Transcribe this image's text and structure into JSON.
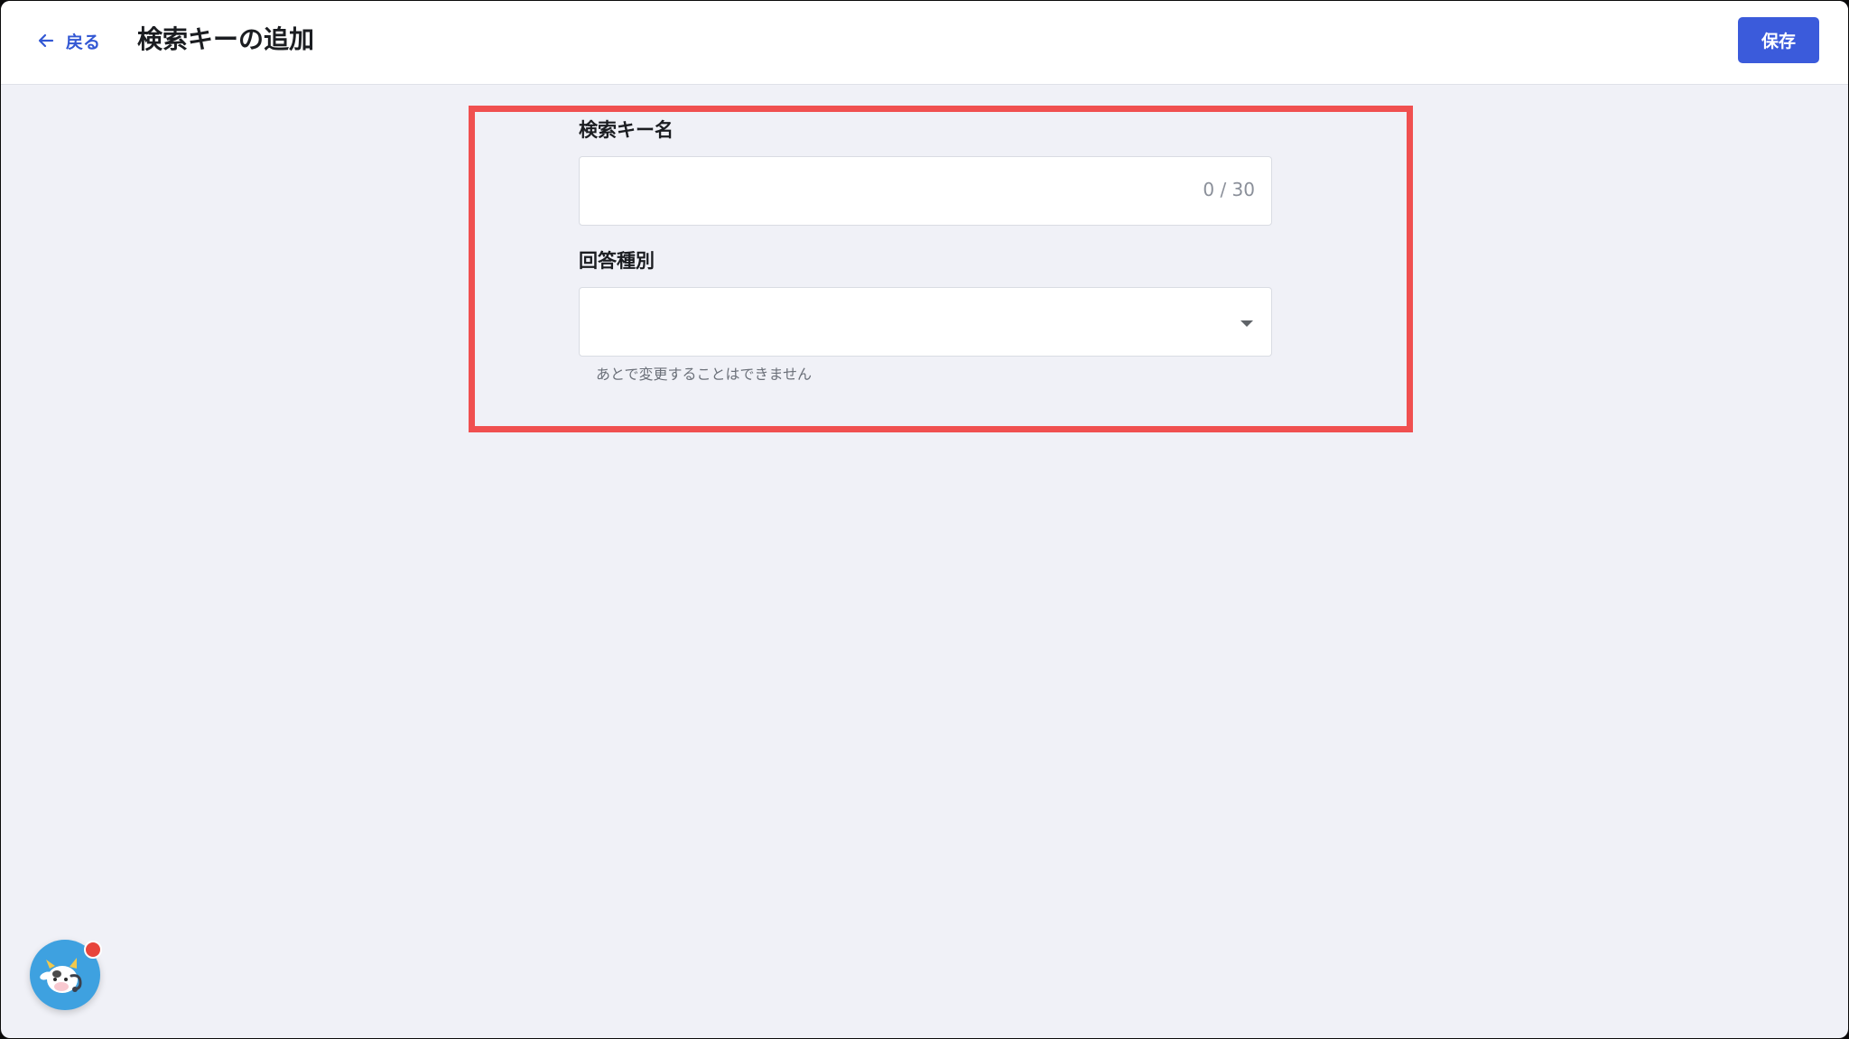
{
  "header": {
    "back_label": "戻る",
    "title": "検索キーの追加",
    "save_label": "保存"
  },
  "form": {
    "search_key_name": {
      "label": "検索キー名",
      "value": "",
      "counter": "0 / 30"
    },
    "answer_type": {
      "label": "回答種別",
      "selected": "",
      "helper": "あとで変更することはできません"
    }
  },
  "chat_widget": {
    "icon": "cow-mascot-icon",
    "has_notification": true
  },
  "colors": {
    "accent": "#3b5bdb",
    "highlight": "#f05050",
    "background": "#f0f1f7",
    "notification": "#e8453c"
  }
}
